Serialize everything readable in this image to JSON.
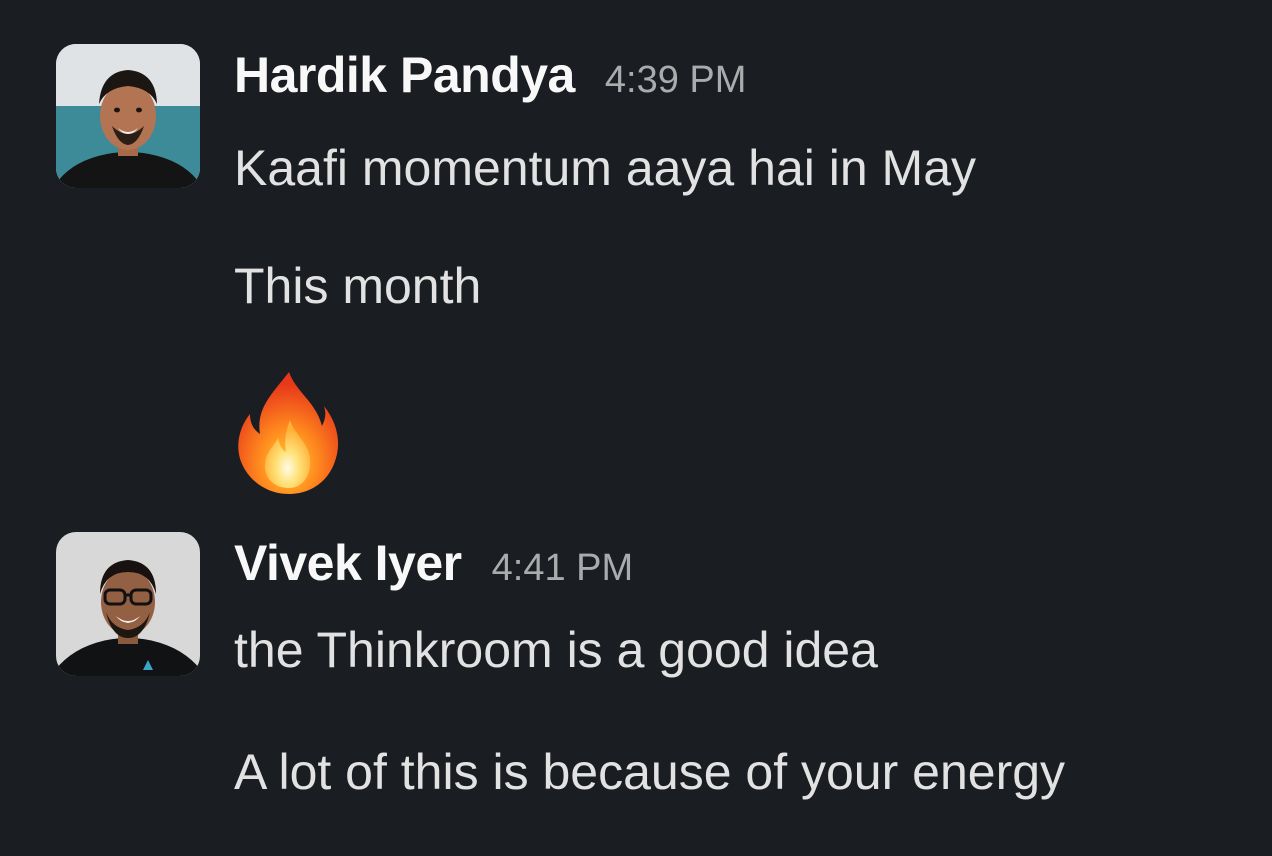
{
  "messages": [
    {
      "sender": "Hardik Pandya",
      "time": "4:39 PM",
      "lines": [
        "Kaafi momentum aaya hai in May",
        "This month"
      ],
      "emoji": "fire-emoji"
    },
    {
      "sender": "Vivek Iyer",
      "time": "4:41 PM",
      "lines": [
        "the Thinkroom is a good idea",
        "A lot of this is because of your energy"
      ]
    }
  ],
  "colors": {
    "background": "#1a1d21",
    "sender_name": "#f8f8f8",
    "timestamp": "#aaabad",
    "message_text": "#e2e2e3"
  }
}
